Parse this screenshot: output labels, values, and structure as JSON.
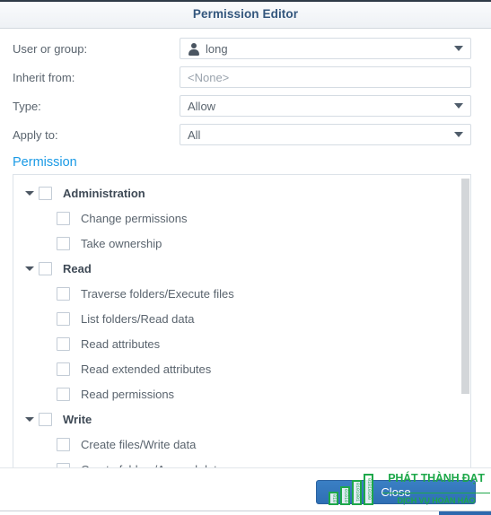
{
  "window": {
    "title": "Permission Editor"
  },
  "form": {
    "rows": [
      {
        "label": "User or group:",
        "value": "long",
        "icon": "user-icon",
        "has_caret": true,
        "placeholder": false
      },
      {
        "label": "Inherit from:",
        "value": "<None>",
        "icon": null,
        "has_caret": false,
        "placeholder": true
      },
      {
        "label": "Type:",
        "value": "Allow",
        "icon": null,
        "has_caret": true,
        "placeholder": false
      },
      {
        "label": "Apply to:",
        "value": "All",
        "icon": null,
        "has_caret": true,
        "placeholder": false
      }
    ]
  },
  "permission": {
    "heading": "Permission",
    "tree": [
      {
        "label": "Administration",
        "type": "group",
        "checked": false,
        "expanded": true
      },
      {
        "label": "Change permissions",
        "type": "child",
        "checked": false
      },
      {
        "label": "Take ownership",
        "type": "child",
        "checked": false
      },
      {
        "label": "Read",
        "type": "group",
        "checked": false,
        "expanded": true
      },
      {
        "label": "Traverse folders/Execute files",
        "type": "child",
        "checked": false
      },
      {
        "label": "List folders/Read data",
        "type": "child",
        "checked": false
      },
      {
        "label": "Read attributes",
        "type": "child",
        "checked": false
      },
      {
        "label": "Read extended attributes",
        "type": "child",
        "checked": false
      },
      {
        "label": "Read permissions",
        "type": "child",
        "checked": false
      },
      {
        "label": "Write",
        "type": "group",
        "checked": false,
        "expanded": true
      },
      {
        "label": "Create files/Write data",
        "type": "child",
        "checked": false
      },
      {
        "label": "Create folders/Append data",
        "type": "child",
        "checked": false
      }
    ]
  },
  "footer": {
    "close_label": "Close"
  },
  "watermark": {
    "title": "PHÁT THÀNH ĐẠT",
    "subtitle": "DỊCH VỤ HOÀN HẢO",
    "bars": [
      "010",
      "01010",
      "0101001",
      "01010100"
    ]
  },
  "colors": {
    "title_text": "#33567d",
    "heading_blue": "#1a9ae5",
    "button_blue": "#2f6fb4",
    "watermark_green": "#1ea84a",
    "label_gray": "#5a646e"
  }
}
